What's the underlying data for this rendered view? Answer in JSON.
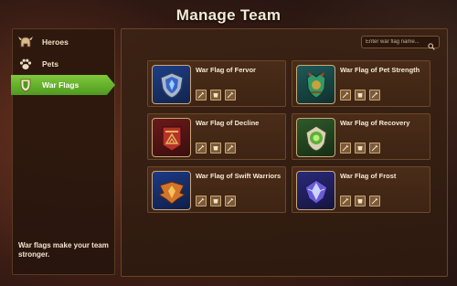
{
  "page": {
    "title": "Manage Team"
  },
  "sidebar": {
    "items": [
      {
        "label": "Heroes",
        "icon": "helmet-icon",
        "active": false
      },
      {
        "label": "Pets",
        "icon": "paw-icon",
        "active": false
      },
      {
        "label": "War Flags",
        "icon": "shield-icon",
        "active": true
      }
    ],
    "note": "War flags make your team stronger."
  },
  "search": {
    "placeholder": "Enter war flag name..."
  },
  "flags": [
    {
      "name": "War Flag of Fervor",
      "emblem": "blue-shield-emblem-icon",
      "color": "#3a64c8"
    },
    {
      "name": "War Flag of Pet Strength",
      "emblem": "green-teal-crest-emblem-icon",
      "color": "#2f9a6a"
    },
    {
      "name": "War Flag of Decline",
      "emblem": "red-banner-emblem-icon",
      "color": "#b8322a"
    },
    {
      "name": "War Flag of Recovery",
      "emblem": "green-orb-emblem-icon",
      "color": "#5fae3a"
    },
    {
      "name": "War Flag of Swift Warriors",
      "emblem": "orange-wings-emblem-icon",
      "color": "#d2742a"
    },
    {
      "name": "War Flag of Frost",
      "emblem": "purple-crystal-emblem-icon",
      "color": "#6b5ad6"
    }
  ],
  "colors": {
    "active_tab": "#6cbb2f",
    "panel": "#3e2414",
    "accent_border": "#caa77a"
  }
}
